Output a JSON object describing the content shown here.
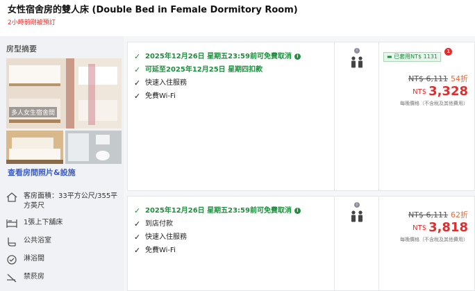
{
  "header": {
    "title": "女性宿舍房的雙人床 (Double Bed in Female Dormitory Room)",
    "booked_note": "2小時前剛被預訂"
  },
  "room_summary": {
    "label": "房型摘要",
    "photo_caption": "多人女生宿舍間",
    "view_link": "查看房間照片&設施",
    "amenities": [
      {
        "icon": "house-icon",
        "text": "客房面積：33平方公尺/355平方英尺"
      },
      {
        "icon": "bunk-bed-icon",
        "text": "1張上下舖床"
      },
      {
        "icon": "shared-bathroom-icon",
        "text": "公共浴室"
      },
      {
        "icon": "shower-icon",
        "text": "淋浴間"
      },
      {
        "icon": "no-smoking-icon",
        "text": "禁菸房"
      }
    ]
  },
  "offers": [
    {
      "conditions": [
        {
          "type": "green",
          "text": "2025年12月26日 星期五23:59前可免費取消",
          "info": true
        },
        {
          "type": "green",
          "text": "可延至2025年12月25日 星期四扣款",
          "info": false
        },
        {
          "type": "plain",
          "text": "快速入住服務",
          "info": false
        },
        {
          "type": "plain",
          "text": "免費Wi-Fi",
          "info": false
        }
      ],
      "coupon": "已套用NT$ 1131",
      "coupon_badge": "1",
      "original_price": "NT$ 6,111",
      "discount": "54折",
      "currency": "NT$",
      "price": "3,328",
      "per_night_note": "每晚價格（不含稅及其他費用）"
    },
    {
      "conditions": [
        {
          "type": "green",
          "text": "2025年12月26日 星期五23:59前可免費取消",
          "info": true
        },
        {
          "type": "plain",
          "text": "到店付款",
          "info": false
        },
        {
          "type": "plain",
          "text": "快速入住服務",
          "info": false
        },
        {
          "type": "plain",
          "text": "免費Wi-Fi",
          "info": false
        }
      ],
      "original_price": "NT$ 6,111",
      "discount": "62折",
      "currency": "NT$",
      "price": "3,818",
      "per_night_note": "每晚價格（不含稅及其他費用）"
    }
  ],
  "colors": {
    "green": "#1c8e3c",
    "red": "#e12d2d",
    "link": "#3b5cc4"
  }
}
